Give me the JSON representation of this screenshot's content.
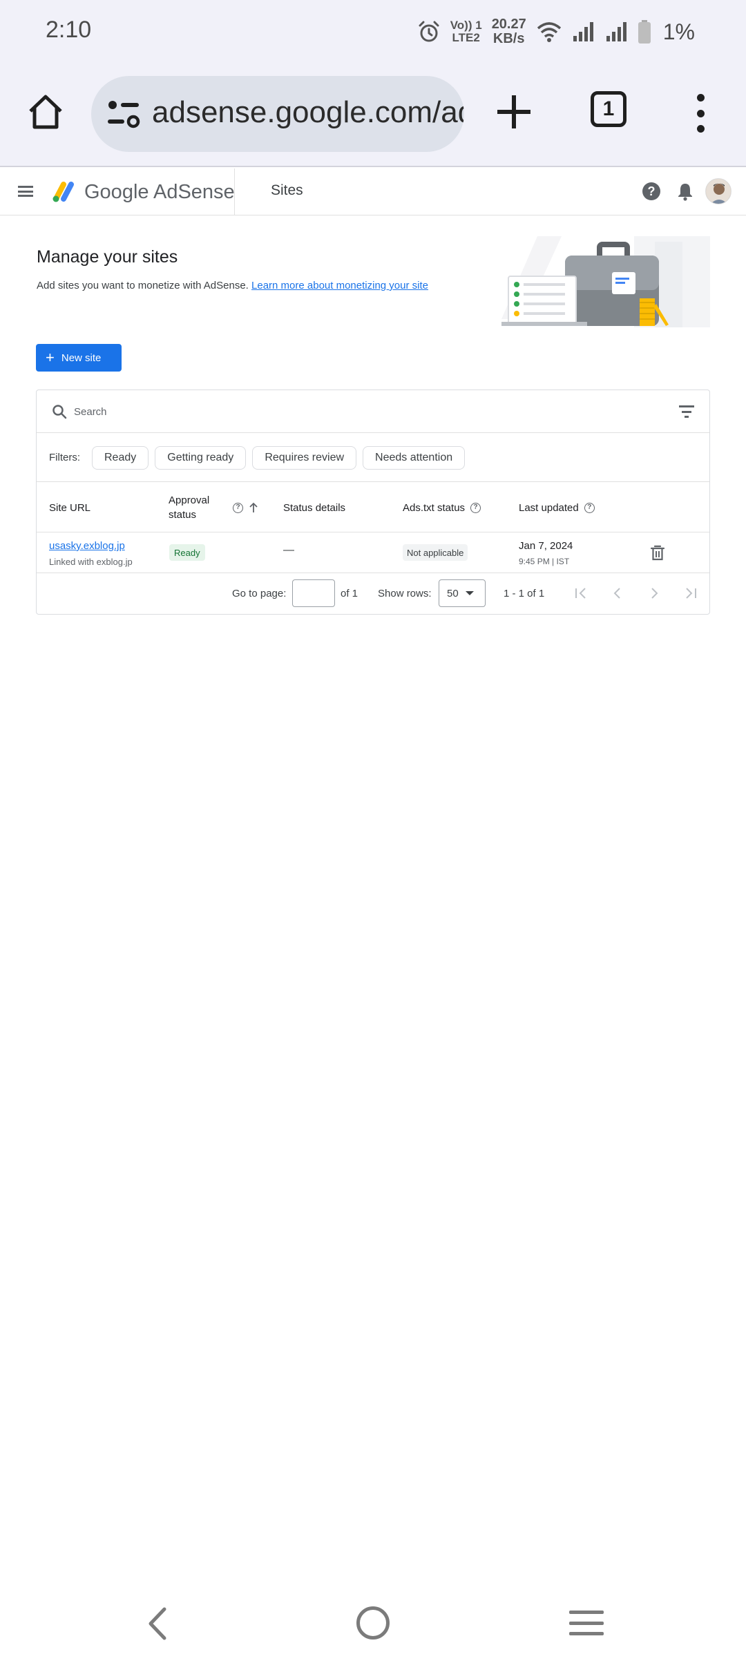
{
  "status_bar": {
    "time": "2:10",
    "volte_top": "Vo)) 1",
    "volte_bottom": "LTE2",
    "speed_value": "20.27",
    "speed_unit": "KB/s",
    "battery": "1%"
  },
  "browser": {
    "url": "adsense.google.com/adsense",
    "tab_count": "1"
  },
  "header": {
    "brand": "Google AdSense",
    "section_title": "Sites",
    "help_glyph": "?"
  },
  "hero": {
    "title": "Manage your sites",
    "description": "Add sites you want to monetize with AdSense.",
    "learn_more": "Learn more about monetizing your site"
  },
  "new_site_button": {
    "plus": "+",
    "label": "New site"
  },
  "search": {
    "placeholder": "Search"
  },
  "filters": {
    "label": "Filters:",
    "chips": [
      "Ready",
      "Getting ready",
      "Requires review",
      "Needs attention"
    ]
  },
  "table": {
    "columns": {
      "site_url": "Site URL",
      "approval_line1": "Approval",
      "approval_line2": "status",
      "status_details": "Status details",
      "ads_txt": "Ads.txt status",
      "last_updated": "Last updated"
    },
    "help_glyph": "?",
    "rows": [
      {
        "site_url": "usasky.exblog.jp",
        "linked": "Linked with exblog.jp",
        "approval": "Ready",
        "status_details": "—",
        "ads_txt": "Not applicable",
        "date": "Jan 7, 2024",
        "time": "9:45 PM | IST"
      }
    ]
  },
  "pagination": {
    "go_to_label": "Go to page:",
    "of_label": "of 1",
    "show_rows_label": "Show rows:",
    "rows_value": "50",
    "range": "1 - 1 of 1"
  },
  "colors": {
    "accent": "#1a73e8",
    "ready_bg": "#e6f4ea",
    "ready_text": "#137333",
    "browser_bg": "#f1f1f9"
  }
}
